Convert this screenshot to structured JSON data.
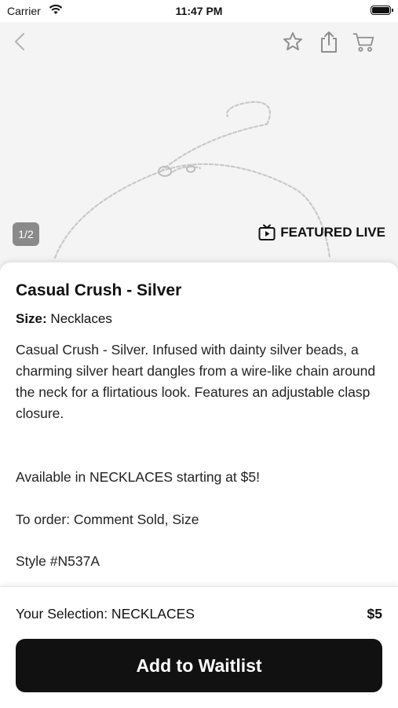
{
  "status_bar": {
    "carrier": "Carrier",
    "time": "11:47 PM"
  },
  "hero": {
    "counter": "1/2",
    "badge": "FEATURED LIVE"
  },
  "icons": {
    "back": "chevron-left-icon",
    "favorite": "star-icon",
    "share": "share-icon",
    "cart": "cart-icon",
    "live": "tv-play-icon"
  },
  "product": {
    "title": "Casual Crush - Silver",
    "size_label": "Size:",
    "size_value": "Necklaces",
    "description": "Casual Crush - Silver. Infused with dainty silver beads, a charming silver heart dangles from a wire-like chain around the neck for a flirtatious look. Features an adjustable clasp closure.",
    "availability": "Available in NECKLACES starting at $5!",
    "order_info": "To order: Comment Sold, Size",
    "style": "Style #N537A"
  },
  "footer": {
    "selection": "Your Selection: NECKLACES",
    "price": "$5",
    "button_label": "Add to Waitlist"
  },
  "colors": {
    "button_bg": "#111111",
    "counter_bg": "#8a8a8a",
    "hero_bg": "#f4f4f4"
  }
}
